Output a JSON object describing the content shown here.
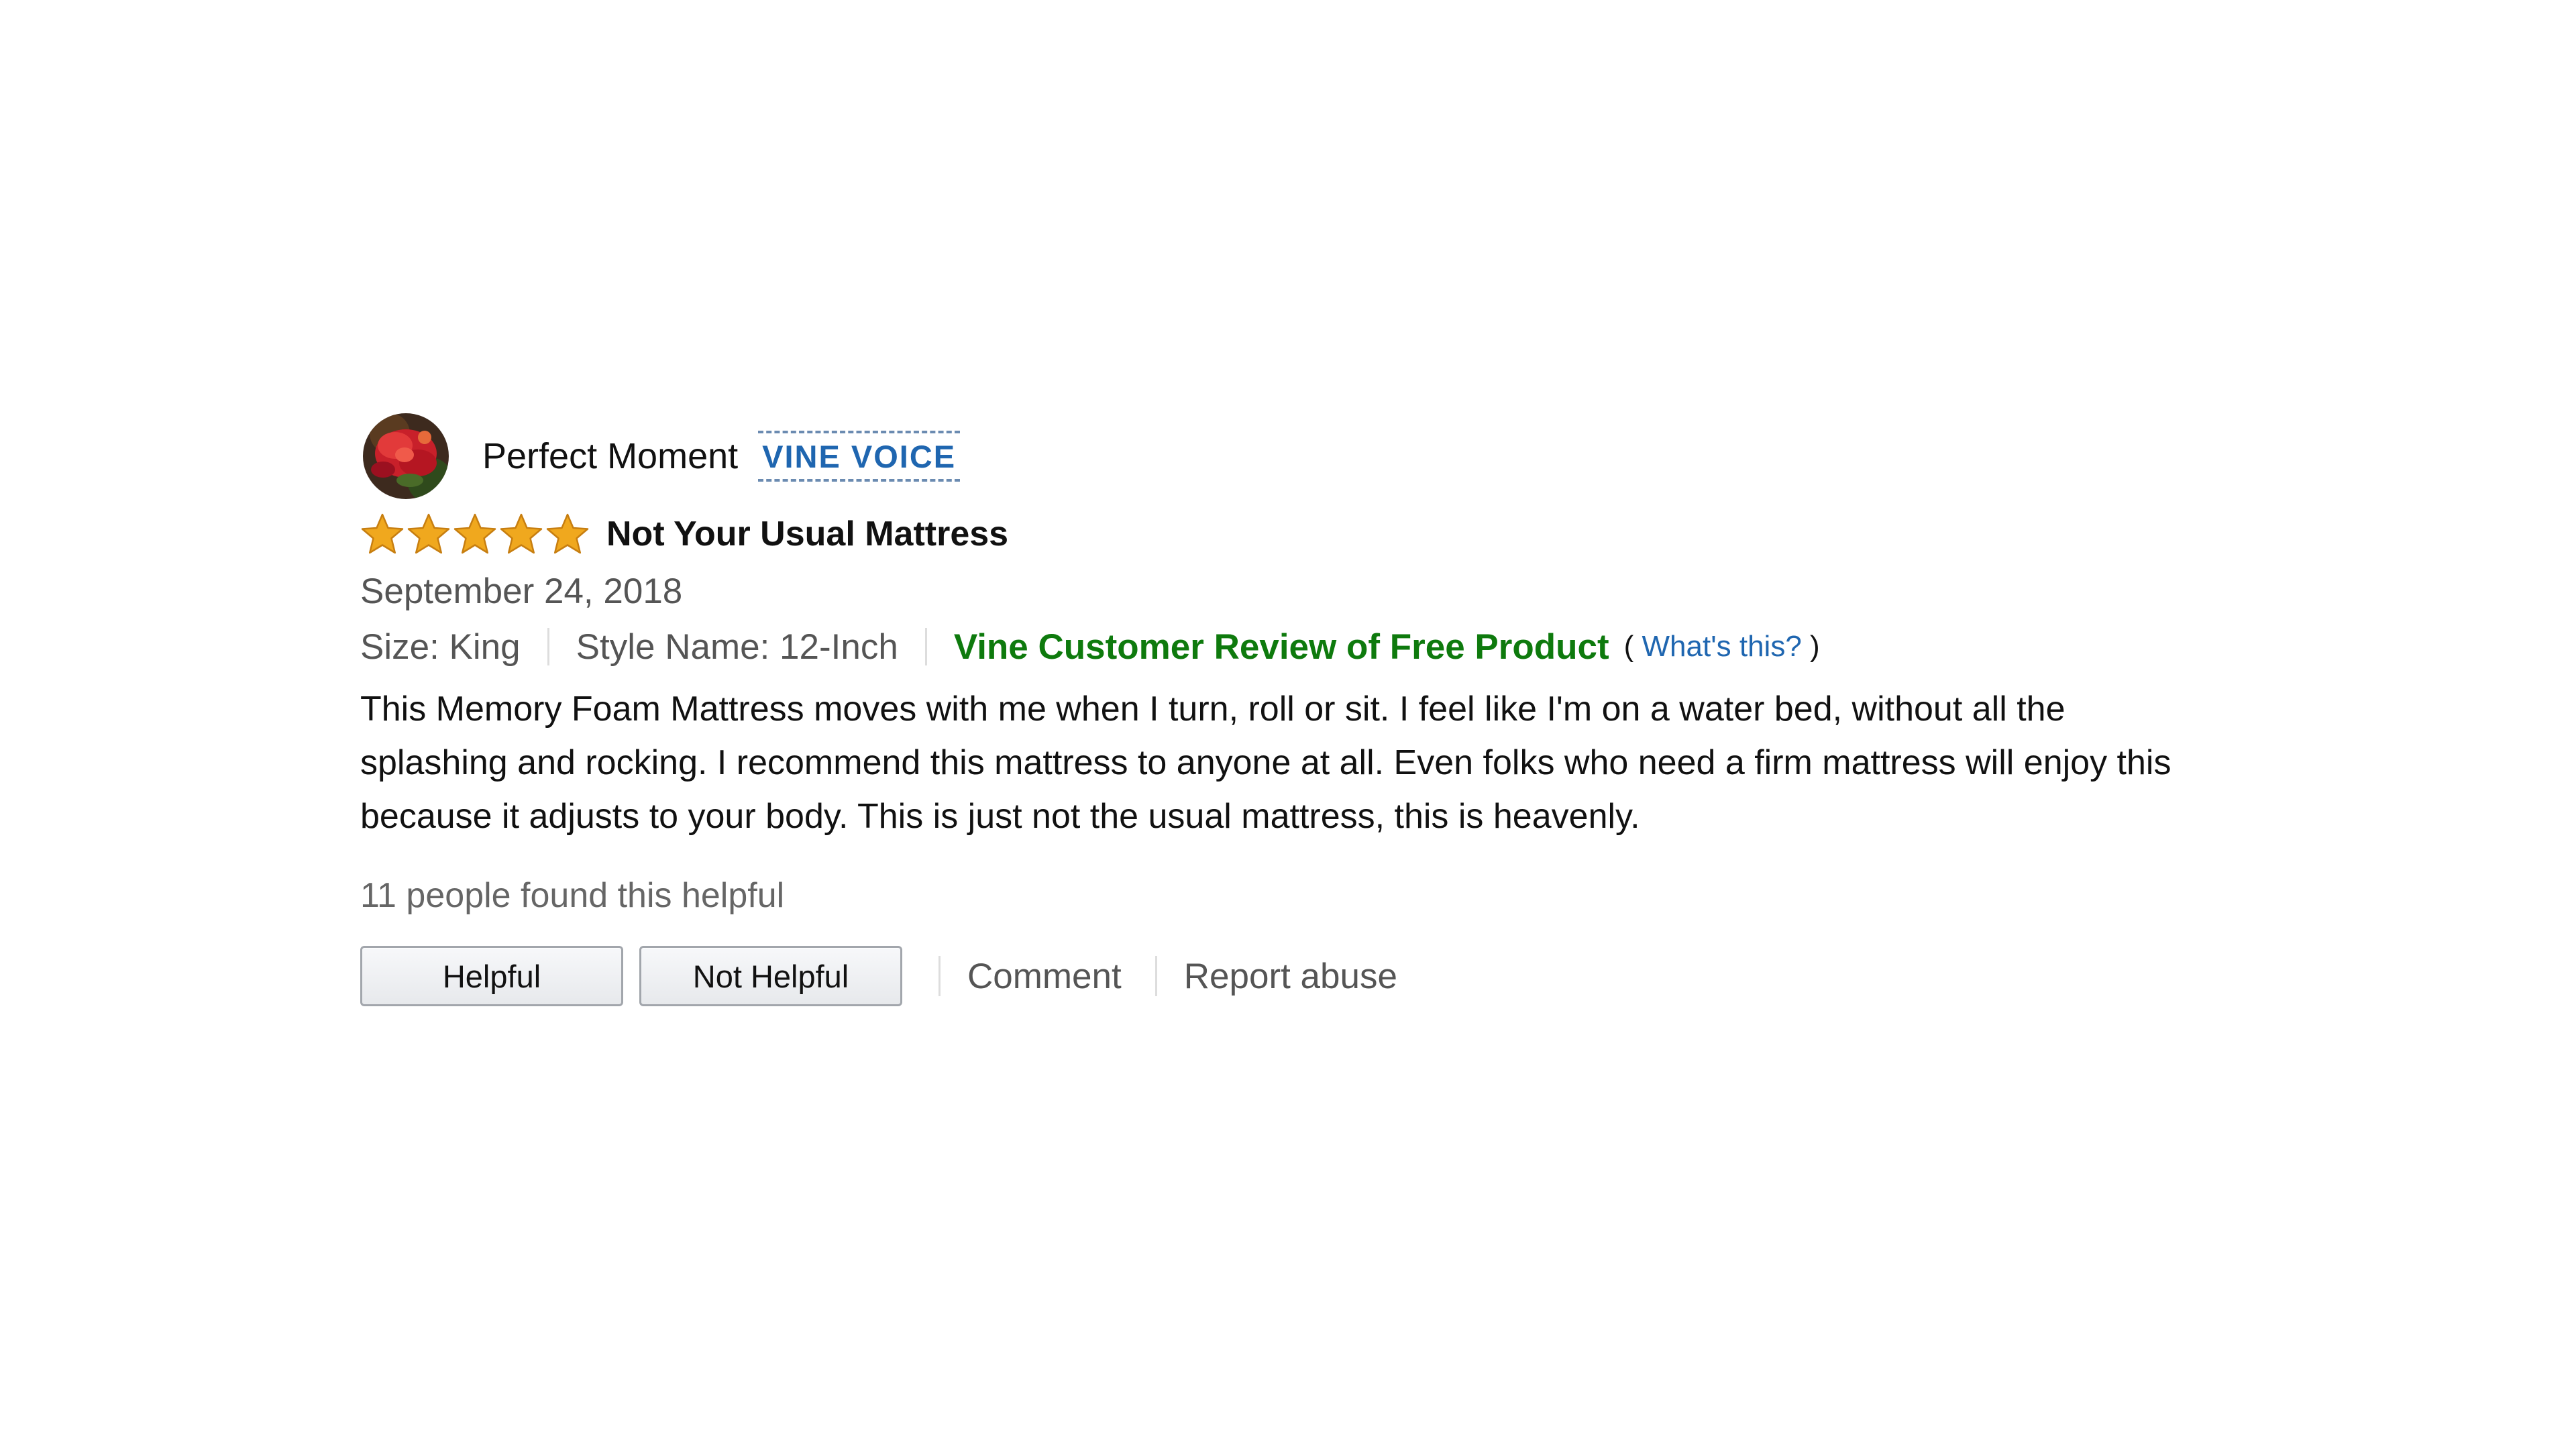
{
  "review": {
    "profile": {
      "name": "Perfect Moment",
      "badge": "VINE VOICE",
      "avatar_icon": "flower-avatar"
    },
    "rating": {
      "stars": 5,
      "max_stars": 5,
      "star_color": "#f0a81e"
    },
    "title": "Not Your Usual Mattress",
    "date": "September 24, 2018",
    "attributes": {
      "size": "Size: King",
      "style": "Style Name: 12-Inch",
      "vine_label": "Vine Customer Review of Free Product",
      "whats_this_open": "(",
      "whats_this": "What's this?",
      "whats_this_close": ")"
    },
    "body": "This Memory Foam Mattress moves with me when I turn, roll or sit. I feel like I'm on a water bed, without all the splashing and rocking. I recommend this mattress to anyone at all. Even folks who need a firm mattress will enjoy this because it adjusts to your body. This is just not the usual mattress, this is heavenly.",
    "helpful_count": "11 people found this helpful",
    "actions": {
      "helpful_button": "Helpful",
      "not_helpful_button": "Not Helpful",
      "comment": "Comment",
      "report_abuse": "Report abuse"
    },
    "colors": {
      "vine_green": "#0e7a0d",
      "link_blue": "#1f66b0",
      "muted_text": "#555555"
    }
  }
}
